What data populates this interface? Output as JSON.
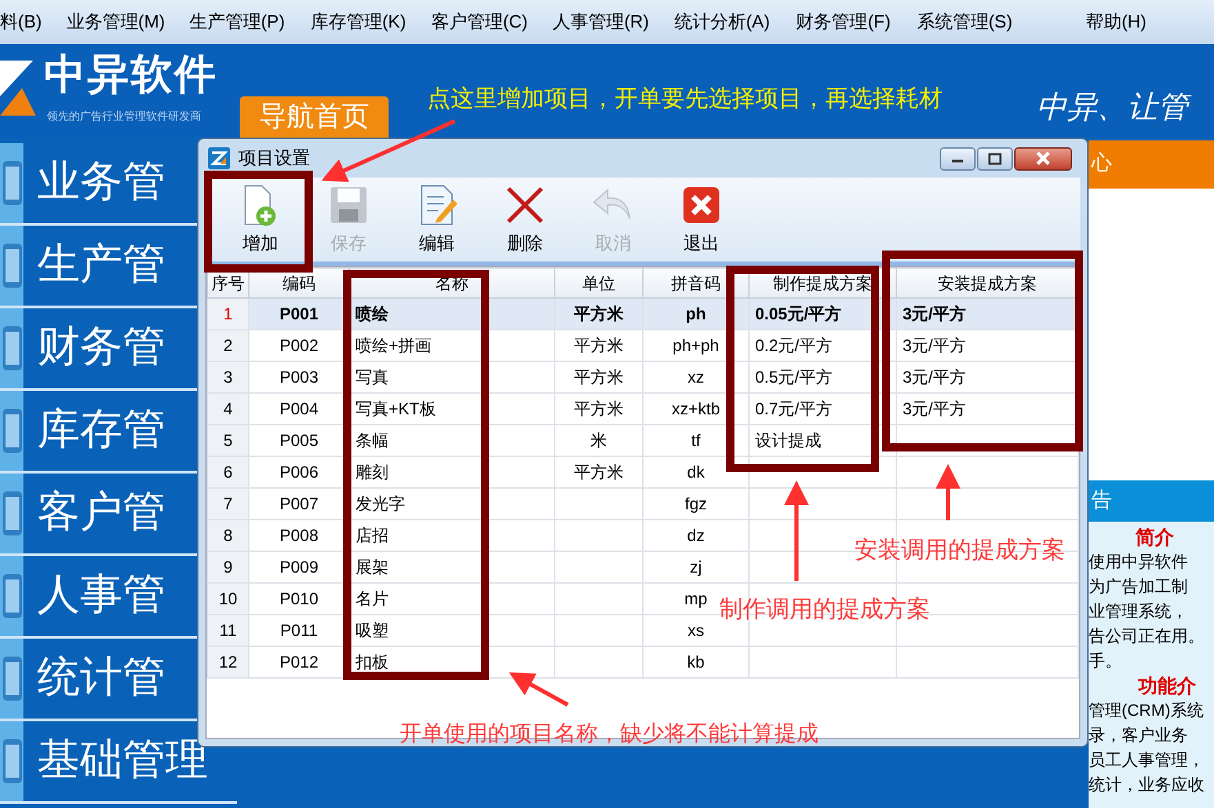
{
  "menu_bar": [
    "料(B)",
    "业务管理(M)",
    "生产管理(P)",
    "库存管理(K)",
    "客户管理(C)",
    "人事管理(R)",
    "统计分析(A)",
    "财务管理(F)",
    "系统管理(S)",
    "帮助(H)"
  ],
  "header": {
    "logo_title": "中异软件",
    "logo_subtitle": "领先的广告行业管理软件研发商",
    "nav_tab": "导航首页",
    "slogan": "中异、让管"
  },
  "sidebar": {
    "items": [
      "业务管",
      "生产管",
      "财务管",
      "库存管",
      "客户管",
      "人事管",
      "统计管",
      "基础管理"
    ]
  },
  "right_panel": {
    "header_top": "心",
    "header_bottom": "告",
    "intro_title": "简介",
    "intro_lines": [
      "使用中异软件",
      "为广告加工制",
      "业管理系统，",
      "告公司正在用。",
      "手。"
    ],
    "features_title": "功能介",
    "features_lines": [
      "管理(CRM)系统",
      "录，客户业务",
      "员工人事管理，",
      "统计，业务应收"
    ]
  },
  "dialog": {
    "title": "项目设置",
    "toolbar": [
      {
        "kind": "add",
        "label": "增加",
        "disabled": false
      },
      {
        "kind": "save",
        "label": "保存",
        "disabled": true
      },
      {
        "kind": "edit",
        "label": "编辑",
        "disabled": false
      },
      {
        "kind": "delete",
        "label": "删除",
        "disabled": false
      },
      {
        "kind": "cancel",
        "label": "取消",
        "disabled": true
      },
      {
        "kind": "exit",
        "label": "退出",
        "disabled": false
      }
    ],
    "columns": [
      "序号",
      "编码",
      "名称",
      "单位",
      "拼音码",
      "制作提成方案",
      "安装提成方案"
    ],
    "rows": [
      {
        "cells": [
          "1",
          "P001",
          "喷绘",
          "平方米",
          "ph",
          "0.05元/平方",
          "3元/平方"
        ],
        "selected": true
      },
      {
        "cells": [
          "2",
          "P002",
          "喷绘+拼画",
          "平方米",
          "ph+ph",
          "0.2元/平方",
          "3元/平方"
        ],
        "selected": false
      },
      {
        "cells": [
          "3",
          "P003",
          "写真",
          "平方米",
          "xz",
          "0.5元/平方",
          "3元/平方"
        ],
        "selected": false
      },
      {
        "cells": [
          "4",
          "P004",
          "写真+KT板",
          "平方米",
          "xz+ktb",
          "0.7元/平方",
          "3元/平方"
        ],
        "selected": false
      },
      {
        "cells": [
          "5",
          "P005",
          "条幅",
          "米",
          "tf",
          "设计提成",
          ""
        ],
        "selected": false
      },
      {
        "cells": [
          "6",
          "P006",
          "雕刻",
          "平方米",
          "dk",
          "",
          ""
        ],
        "selected": false
      },
      {
        "cells": [
          "7",
          "P007",
          "发光字",
          "",
          "fgz",
          "",
          ""
        ],
        "selected": false
      },
      {
        "cells": [
          "8",
          "P008",
          "店招",
          "",
          "dz",
          "",
          ""
        ],
        "selected": false
      },
      {
        "cells": [
          "9",
          "P009",
          "展架",
          "",
          "zj",
          "",
          ""
        ],
        "selected": false
      },
      {
        "cells": [
          "10",
          "P010",
          "名片",
          "",
          "mp",
          "",
          ""
        ],
        "selected": false
      },
      {
        "cells": [
          "11",
          "P011",
          "吸塑",
          "",
          "xs",
          "",
          ""
        ],
        "selected": false
      },
      {
        "cells": [
          "12",
          "P012",
          "扣板",
          "",
          "kb",
          "",
          ""
        ],
        "selected": false
      }
    ]
  },
  "annotations": {
    "top_note": "点这里增加项目，开单要先选择项目，再选择耗材",
    "install_note": "安装调用的提成方案",
    "make_note": "制作调用的提成方案",
    "name_note": "开单使用的项目名称，缺少将不能计算提成"
  }
}
